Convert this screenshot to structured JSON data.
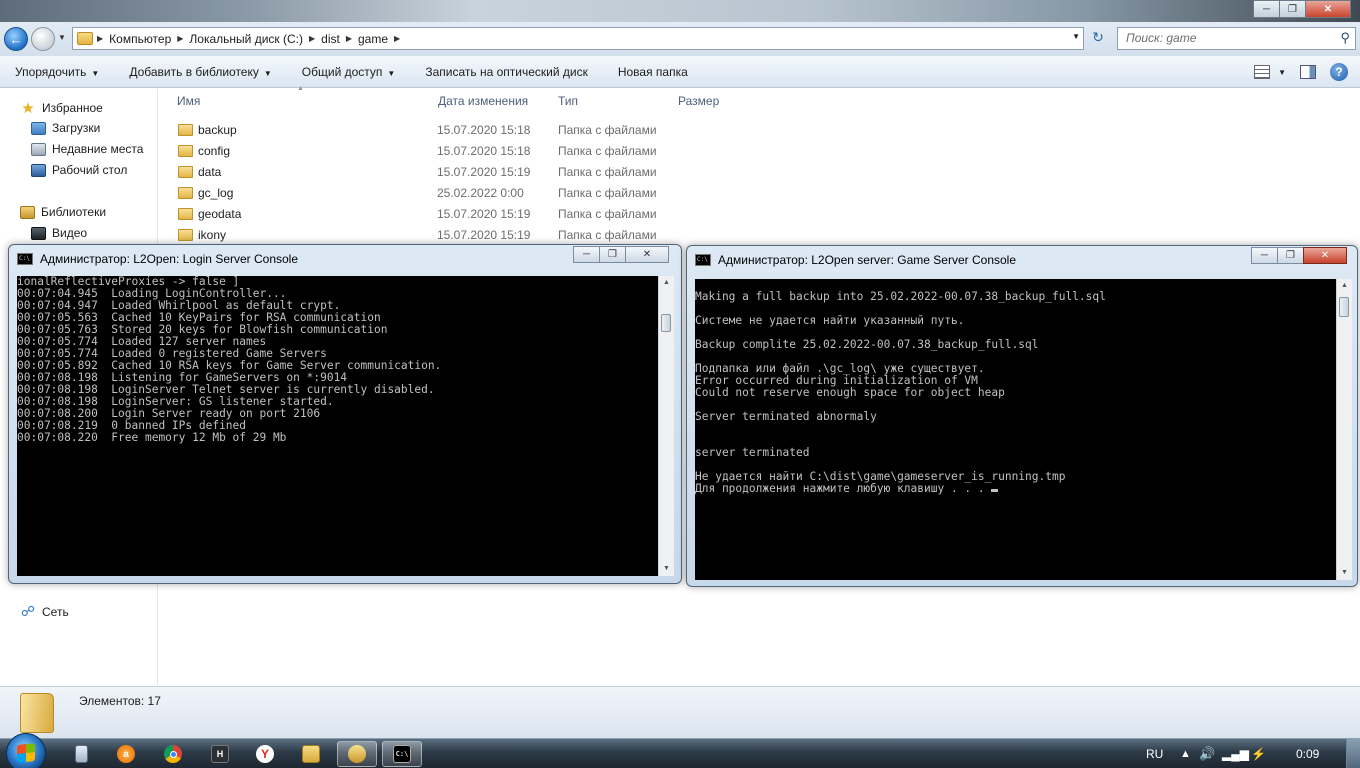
{
  "explorer": {
    "breadcrumb": [
      "Компьютер",
      "Локальный диск (C:)",
      "dist",
      "game"
    ],
    "search_placeholder": "Поиск: game",
    "toolbar": {
      "organize": "Упорядочить",
      "add_to_library": "Добавить в библиотеку",
      "share": "Общий доступ",
      "burn": "Записать на оптический диск",
      "new_folder": "Новая папка"
    },
    "nav": {
      "favorites": "Избранное",
      "downloads": "Загрузки",
      "recent": "Недавние места",
      "desktop": "Рабочий стол",
      "libraries": "Библиотеки",
      "video": "Видео",
      "network": "Сеть"
    },
    "columns": {
      "name": "Имя",
      "date": "Дата изменения",
      "type": "Тип",
      "size": "Размер"
    },
    "files": [
      {
        "name": "backup",
        "date": "15.07.2020 15:18",
        "type": "Папка с файлами"
      },
      {
        "name": "config",
        "date": "15.07.2020 15:18",
        "type": "Папка с файлами"
      },
      {
        "name": "data",
        "date": "15.07.2020 15:19",
        "type": "Папка с файлами"
      },
      {
        "name": "gc_log",
        "date": "25.02.2022 0:00",
        "type": "Папка с файлами"
      },
      {
        "name": "geodata",
        "date": "15.07.2020 15:19",
        "type": "Папка с файлами"
      },
      {
        "name": "ikony",
        "date": "15.07.2020 15:19",
        "type": "Папка с файлами"
      }
    ],
    "status": "Элементов: 17"
  },
  "login_console": {
    "title": "Администратор:  L2Open: Login Server Console",
    "lines": [
      "ionalReflectiveProxies -> false ]",
      "00:07:04.945  Loading LoginController...",
      "00:07:04.947  Loaded Whirlpool as default crypt.",
      "00:07:05.563  Cached 10 KeyPairs for RSA communication",
      "00:07:05.763  Stored 20 keys for Blowfish communication",
      "00:07:05.774  Loaded 127 server names",
      "00:07:05.774  Loaded 0 registered Game Servers",
      "00:07:05.892  Cached 10 RSA keys for Game Server communication.",
      "00:07:08.198  Listening for GameServers on *:9014",
      "00:07:08.198  LoginServer Telnet server is currently disabled.",
      "00:07:08.198  LoginServer: GS listener started.",
      "00:07:08.200  Login Server ready on port 2106",
      "00:07:08.219  0 banned IPs defined",
      "00:07:08.220  Free memory 12 Mb of 29 Mb"
    ]
  },
  "game_console": {
    "title": "Администратор:  L2Open server: Game Server Console",
    "lines": [
      "",
      "Making a full backup into 25.02.2022-00.07.38_backup_full.sql",
      "",
      "Системе не удается найти указанный путь.",
      "",
      "Backup complite 25.02.2022-00.07.38_backup_full.sql",
      "",
      "Подпапка или файл .\\gc_log\\ уже существует.",
      "Error occurred during initialization of VM",
      "Could not reserve enough space for object heap",
      "",
      "Server terminated abnormaly",
      "",
      "",
      "server terminated",
      "",
      "Не удается найти C:\\dist\\game\\gameserver_is_running.tmp",
      "Для продолжения нажмите любую клавишу . . . "
    ]
  },
  "taskbar": {
    "icon_names": [
      "notepad-icon",
      "avast-icon",
      "chrome-icon",
      "app-h-icon",
      "yandex-icon",
      "explorer-icon",
      "winrar-icon",
      "cmd-icon"
    ],
    "lang": "RU",
    "time": "0:09"
  }
}
